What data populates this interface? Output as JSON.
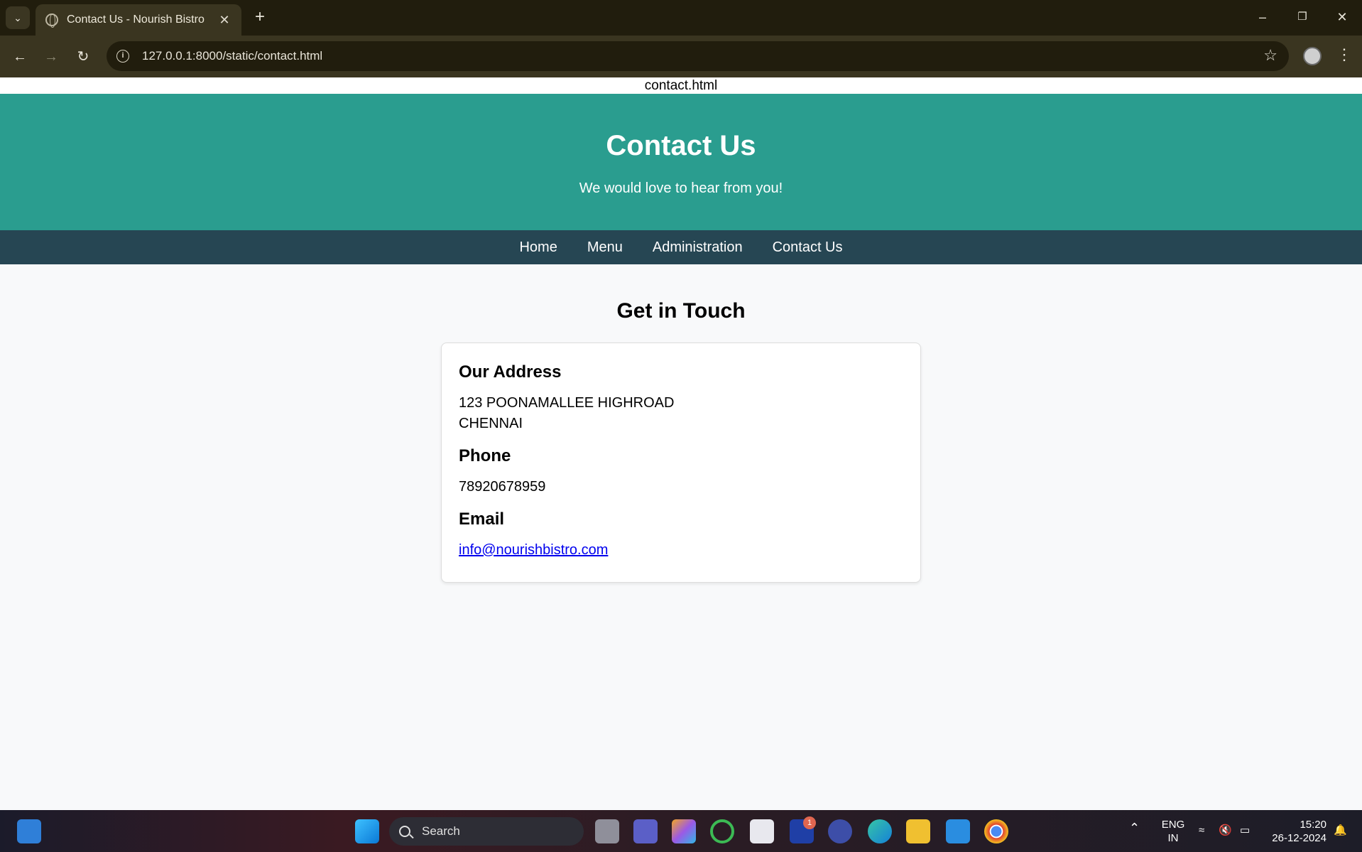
{
  "browser": {
    "tab_title": "Contact Us - Nourish Bistro",
    "url": "127.0.0.1:8000/static/contact.html"
  },
  "page": {
    "file_label": "contact.html",
    "hero": {
      "title": "Contact Us",
      "subtitle": "We would love to hear from you!"
    },
    "nav": [
      {
        "label": "Home"
      },
      {
        "label": "Menu"
      },
      {
        "label": "Administration"
      },
      {
        "label": "Contact Us"
      }
    ],
    "section_title": "Get in Touch",
    "contact": {
      "address_heading": "Our Address",
      "address_line1": "123 POONAMALLEE HIGHROAD",
      "address_line2": "CHENNAI",
      "phone_heading": "Phone",
      "phone": "78920678959",
      "email_heading": "Email",
      "email": "info@nourishbistro.com"
    }
  },
  "taskbar": {
    "search_placeholder": "Search",
    "language": "ENG",
    "region": "IN",
    "time": "15:20",
    "date": "26-12-2024",
    "notification_count": "1"
  },
  "colors": {
    "hero_bg": "#2a9d8f",
    "nav_bg": "#264653",
    "link": "#0000ee"
  }
}
